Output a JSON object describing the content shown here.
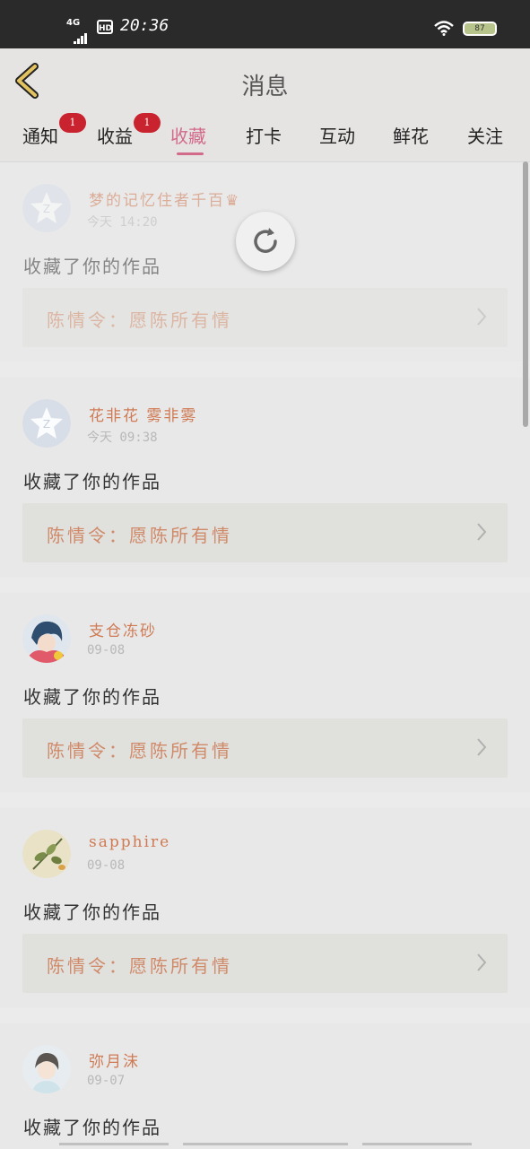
{
  "status_bar": {
    "network": "4G",
    "hd": "HD",
    "time": "20:36",
    "battery": "87"
  },
  "header": {
    "title": "消息"
  },
  "tabs": [
    {
      "label": "通知",
      "badge": "1"
    },
    {
      "label": "收益",
      "badge": "1"
    },
    {
      "label": "收藏",
      "badge": ""
    },
    {
      "label": "打卡",
      "badge": ""
    },
    {
      "label": "互动",
      "badge": ""
    },
    {
      "label": "鲜花",
      "badge": ""
    },
    {
      "label": "关注",
      "badge": ""
    }
  ],
  "active_tab": "收藏",
  "colors": {
    "accent": "#d26a8a",
    "username": "#cf7a54",
    "badge": "#c8232f"
  },
  "items": [
    {
      "user": "梦的记忆住者千百♛",
      "date": "今天 14:20",
      "action": "收藏了你的作品",
      "work": "陈情令：愿陈所有情",
      "avatar": "default-star-avatar"
    },
    {
      "user": "花非花 雾非雾",
      "date": "今天 09:38",
      "action": "收藏了你的作品",
      "work": "陈情令：愿陈所有情",
      "avatar": "default-star-avatar"
    },
    {
      "user": "支仓冻砂",
      "date": "09-08",
      "action": "收藏了你的作品",
      "work": "陈情令：愿陈所有情",
      "avatar": "anime-girl-avatar"
    },
    {
      "user": "sapphire",
      "date": "09-08",
      "action": "收藏了你的作品",
      "work": "陈情令：愿陈所有情",
      "avatar": "leaf-avatar"
    },
    {
      "user": "弥月沫",
      "date": "09-07",
      "action": "收藏了你的作品",
      "work": "",
      "avatar": "chibi-avatar"
    }
  ]
}
